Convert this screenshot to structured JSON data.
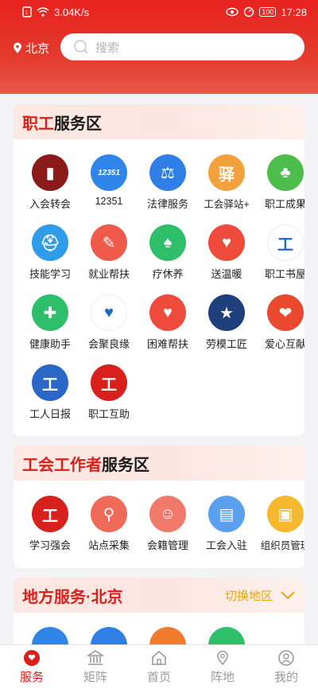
{
  "status": {
    "speed": "3.04K/s",
    "battery": "100",
    "time": "17:28"
  },
  "header": {
    "location": "北京",
    "search_placeholder": "搜索"
  },
  "worker_section": {
    "title_hl": "职工",
    "title_rest": "服务区",
    "items": [
      {
        "label": "入会转会",
        "icon": "membership-book-icon",
        "color": "#8b1a1a"
      },
      {
        "label": "12351",
        "icon": "hotline-12351-icon",
        "color": "#2f86e8"
      },
      {
        "label": "法律服务",
        "icon": "scales-icon",
        "color": "#2f7fe6"
      },
      {
        "label": "工会驿站+",
        "icon": "station-house-icon",
        "color": "#f2a23c"
      },
      {
        "label": "职工成果",
        "icon": "tree-icon",
        "color": "#4cbc4a"
      },
      {
        "label": "技能学习",
        "icon": "helmet-worker-icon",
        "color": "#2f9ce8"
      },
      {
        "label": "就业帮扶",
        "icon": "job-resume-icon",
        "color": "#f05a4a"
      },
      {
        "label": "疗休养",
        "icon": "palm-tree-icon",
        "color": "#2fbf6a"
      },
      {
        "label": "送温暖",
        "icon": "heart-hand-icon",
        "color": "#ee4b3c"
      },
      {
        "label": "职工书屋",
        "icon": "bookhouse-logo-icon",
        "color": "#ffffff"
      },
      {
        "label": "健康助手",
        "icon": "medical-cross-icon",
        "color": "#2fbf6a"
      },
      {
        "label": "会聚良缘",
        "icon": "couple-heart-icon",
        "color": "#ffffff"
      },
      {
        "label": "困难帮扶",
        "icon": "help-heart-icon",
        "color": "#ee4b3c"
      },
      {
        "label": "劳模工匠",
        "icon": "medal-icon",
        "color": "#1f3f7a"
      },
      {
        "label": "爱心互献",
        "icon": "love-exchange-icon",
        "color": "#e8492f"
      },
      {
        "label": "工人日报",
        "icon": "workers-daily-icon",
        "color": "#2a67c7"
      },
      {
        "label": "职工互助",
        "icon": "union-emblem-icon",
        "color": "#d8211c"
      }
    ]
  },
  "unionist_section": {
    "title_hl": "工会工作者",
    "title_rest": "服务区",
    "items": [
      {
        "label": "学习强会",
        "icon": "study-emblem-icon",
        "color": "#d8211c"
      },
      {
        "label": "站点采集",
        "icon": "map-pin-icon",
        "color": "#f06a5a"
      },
      {
        "label": "会籍管理",
        "icon": "member-profile-icon",
        "color": "#f07a6a"
      },
      {
        "label": "工会入驻",
        "icon": "building-docs-icon",
        "color": "#5aa0ee"
      },
      {
        "label": "组织员管理",
        "icon": "id-card-icon",
        "color": "#f5b82e"
      }
    ]
  },
  "local_section": {
    "title": "地方服务·北京",
    "switch_label": "切换地区",
    "icon_colors": [
      "#2f86e8",
      "#2f7fe6",
      "#f07a2e",
      "#2fbf6a"
    ]
  },
  "tabs": [
    {
      "label": "服务",
      "active": true
    },
    {
      "label": "矩阵",
      "active": false
    },
    {
      "label": "首页",
      "active": false
    },
    {
      "label": "阵地",
      "active": false
    },
    {
      "label": "我的",
      "active": false
    }
  ]
}
